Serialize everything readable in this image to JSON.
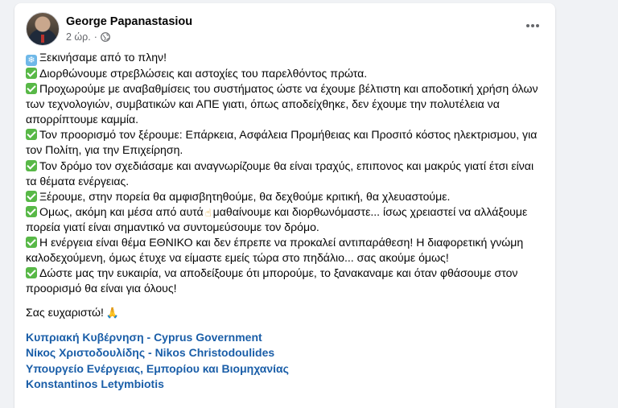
{
  "post": {
    "author_name": "George Papanastasiou",
    "timestamp": "2 ώρ.",
    "separator": "·",
    "privacy_icon": "globe-icon",
    "more_icon": "more-horizontal-icon"
  },
  "content": {
    "lines": [
      {
        "emoji": "snowflake",
        "text": "Ξεκινήσαμε από το πλην!"
      },
      {
        "emoji": "check",
        "text": "Διορθώνουμε στρεβλώσεις και αστοχίες του παρελθόντος πρώτα."
      },
      {
        "emoji": "check",
        "text": "Προχωρούμε με αναβαθμίσεις του συστήματος ώστε να έχουμε βέλτιστη και αποδοτική χρήση όλων των τεχνολογιών, συμβατικών και ΑΠΕ γιατι, όπως αποδείχθηκε, δεν έχουμε την πολυτέλεια να απορρίπτουμε καμμία."
      },
      {
        "emoji": "check",
        "text": "Τον προορισμό τον ξέρουμε: Επάρκεια, Ασφάλεια Προμήθειας και Προσιτό κόστος ηλεκτρισμου, για τον Πολίτη, για την Επιχείρηση."
      },
      {
        "emoji": "check",
        "text": "Τον δρόμο τον σχεδιάσαμε και αναγνωρίζουμε θα είναι τραχύς, επιπονος και μακρύς γιατί έτσι είναι τα θέματα ενέργειας."
      },
      {
        "emoji": "check",
        "text": "Ξέρουμε, στην πορεία θα αμφισβητηθούμε, θα δεχθούμε κριτική, θα χλευαστούμε."
      },
      {
        "emoji": "check",
        "text_before": "Ομως, ακόμη και μέσα από αυτά",
        "inline_emoji": "☝",
        "text": "μαθαίνουμε και διορθωνόμαστε... ίσως χρειαστεί να αλλάξουμε πορεία γιατί είναι σημαντικό να συντομεύσουμε τον δρόμο."
      },
      {
        "emoji": "check",
        "text": "Η ενέργεια είναι θέμα ΕΘΝΙΚΟ και δεν έπρεπε να προκαλεί αντιπαράθεση! Η διαφορετική γνώμη καλοδεχούμενη, όμως έτυχε να είμαστε εμείς τώρα στο πηδάλιο... σας ακούμε όμως!"
      },
      {
        "emoji": "check",
        "text": "Δώστε μας την ευκαιρία, να αποδείξουμε ότι μπορούμε, το ξανακαναμε και όταν φθάσουμε στον προορισμό θα είναι για όλους!"
      }
    ],
    "thanks": "Σας ευχαριστώ!",
    "thanks_emoji": "🙏",
    "tags": [
      "Κυπριακή Κυβέρνηση - Cyprus Government",
      "Νίκος Χριστοδουλίδης - Nikos Christodoulides",
      "Υπουργείο Ενέργειας, Εμπορίου και Βιομηχανίας",
      "Konstantinos Letymbiotis"
    ]
  },
  "colors": {
    "background": "#f0f2f5",
    "card": "#ffffff",
    "link": "#1a5ea8",
    "check_emoji": "#58b847",
    "snow_emoji": "#6fb8e8",
    "meta_text": "#65676b"
  }
}
